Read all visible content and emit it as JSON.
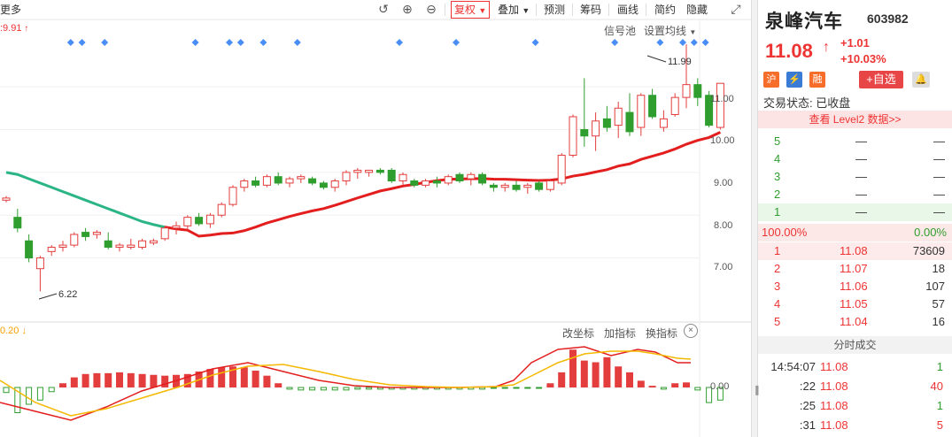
{
  "toolbar": {
    "more_label": "更多",
    "undo_icon": "undo-icon",
    "zoom_in_icon": "zoom-in-icon",
    "zoom_out_icon": "zoom-out-icon",
    "fq_label": "复权",
    "overlay_label": "叠加",
    "forecast_label": "预测",
    "chips_label": "筹码",
    "draw_label": "画线",
    "simple_label": "简约",
    "hide_label": "隐藏",
    "fullscreen_icon": "fullscreen-icon"
  },
  "kline": {
    "ma_label": ":9.91",
    "signal_pool_label": "信号池",
    "set_ma_label": "设置均线",
    "y_ticks": [
      "11.00",
      "10.00",
      "9.00",
      "8.00",
      "7.00"
    ],
    "high_marker": "11.99",
    "low_marker": "6.22",
    "colors": {
      "up": "#e33d3d",
      "down": "#2f9e2f",
      "ma_green": "#2bb585",
      "ma_yellow": "#f5b800",
      "ma_red": "#e31e1e",
      "signal": "#4a8ef5"
    }
  },
  "indicator": {
    "value_label": "0.20",
    "change_axis_label": "改坐标",
    "add_indicator_label": "加指标",
    "switch_indicator_label": "换指标",
    "close_icon": "close-icon",
    "zero_label": "0.00"
  },
  "quote": {
    "name": "泉峰汽车",
    "code": "603982",
    "price": "11.08",
    "change": "+1.01",
    "change_pct": "+10.03%",
    "badge_hu": "沪",
    "badge_lightning": "⚡",
    "badge_rong": "融",
    "fav_label": "+自选",
    "status_label": "交易状态:",
    "status_value": "已收盘",
    "level2_label": "查看 Level2 数据>>",
    "sell_levels": [
      {
        "level": "5",
        "price": "—",
        "vol": "—"
      },
      {
        "level": "4",
        "price": "—",
        "vol": "—"
      },
      {
        "level": "3",
        "price": "—",
        "vol": "—"
      },
      {
        "level": "2",
        "price": "—",
        "vol": "—"
      },
      {
        "level": "1",
        "price": "—",
        "vol": "—"
      }
    ],
    "ratio_left": "100.00%",
    "ratio_right": "0.00%",
    "buy_levels": [
      {
        "level": "1",
        "price": "11.08",
        "vol": "73609"
      },
      {
        "level": "2",
        "price": "11.07",
        "vol": "18"
      },
      {
        "level": "3",
        "price": "11.06",
        "vol": "107"
      },
      {
        "level": "4",
        "price": "11.05",
        "vol": "57"
      },
      {
        "level": "5",
        "price": "11.04",
        "vol": "16"
      }
    ],
    "ticks_header": "分时成交",
    "ticks": [
      {
        "time": "14:54:07",
        "price": "11.08",
        "vol": "1"
      },
      {
        "time": ":22",
        "price": "11.08",
        "vol": "40"
      },
      {
        "time": ":25",
        "price": "11.08",
        "vol": "1"
      },
      {
        "time": ":31",
        "price": "11.08",
        "vol": "5"
      }
    ]
  },
  "chart_data": {
    "type": "candlestick",
    "ylim": [
      6.0,
      12.2
    ],
    "candles": [
      [
        8.35,
        8.45,
        8.3,
        8.4
      ],
      [
        7.95,
        8.15,
        7.6,
        7.7
      ],
      [
        7.4,
        7.55,
        6.9,
        7.0
      ],
      [
        6.75,
        7.05,
        6.22,
        7.0
      ],
      [
        7.15,
        7.3,
        7.05,
        7.25
      ],
      [
        7.25,
        7.4,
        7.15,
        7.3
      ],
      [
        7.3,
        7.6,
        7.25,
        7.55
      ],
      [
        7.6,
        7.7,
        7.4,
        7.5
      ],
      [
        7.55,
        7.65,
        7.45,
        7.6
      ],
      [
        7.4,
        7.6,
        7.2,
        7.25
      ],
      [
        7.25,
        7.35,
        7.15,
        7.3
      ],
      [
        7.25,
        7.45,
        7.2,
        7.3
      ],
      [
        7.25,
        7.45,
        7.2,
        7.4
      ],
      [
        7.35,
        7.45,
        7.3,
        7.4
      ],
      [
        7.45,
        7.75,
        7.4,
        7.7
      ],
      [
        7.7,
        7.85,
        7.55,
        7.75
      ],
      [
        7.75,
        8.0,
        7.65,
        7.95
      ],
      [
        7.95,
        8.05,
        7.75,
        7.8
      ],
      [
        7.8,
        8.05,
        7.7,
        8.0
      ],
      [
        8.0,
        8.3,
        7.95,
        8.25
      ],
      [
        8.25,
        8.7,
        8.2,
        8.65
      ],
      [
        8.65,
        8.85,
        8.55,
        8.8
      ],
      [
        8.8,
        8.9,
        8.65,
        8.7
      ],
      [
        8.7,
        8.95,
        8.65,
        8.9
      ],
      [
        8.9,
        9.0,
        8.7,
        8.75
      ],
      [
        8.75,
        8.9,
        8.65,
        8.85
      ],
      [
        8.85,
        8.95,
        8.75,
        8.9
      ],
      [
        8.85,
        8.9,
        8.7,
        8.75
      ],
      [
        8.75,
        8.8,
        8.6,
        8.65
      ],
      [
        8.65,
        8.85,
        8.55,
        8.8
      ],
      [
        8.8,
        9.05,
        8.7,
        9.0
      ],
      [
        9.0,
        9.1,
        8.85,
        9.05
      ],
      [
        9.0,
        9.05,
        8.9,
        9.05
      ],
      [
        9.05,
        9.1,
        8.95,
        9.0
      ],
      [
        9.05,
        9.1,
        8.75,
        8.8
      ],
      [
        8.8,
        9.0,
        8.7,
        8.95
      ],
      [
        8.8,
        8.85,
        8.65,
        8.7
      ],
      [
        8.7,
        8.85,
        8.65,
        8.8
      ],
      [
        8.8,
        8.9,
        8.65,
        8.75
      ],
      [
        8.75,
        8.95,
        8.7,
        8.9
      ],
      [
        8.95,
        9.0,
        8.75,
        8.8
      ],
      [
        8.85,
        9.0,
        8.7,
        8.95
      ],
      [
        8.95,
        9.0,
        8.7,
        8.75
      ],
      [
        8.7,
        8.75,
        8.55,
        8.65
      ],
      [
        8.65,
        8.75,
        8.55,
        8.7
      ],
      [
        8.7,
        8.8,
        8.55,
        8.6
      ],
      [
        8.65,
        8.75,
        8.5,
        8.7
      ],
      [
        8.75,
        8.8,
        8.55,
        8.6
      ],
      [
        8.6,
        8.85,
        8.55,
        8.8
      ],
      [
        8.75,
        9.45,
        8.7,
        9.4
      ],
      [
        9.4,
        10.35,
        9.35,
        10.3
      ],
      [
        10.0,
        11.2,
        9.6,
        9.85
      ],
      [
        9.85,
        10.4,
        9.5,
        10.2
      ],
      [
        10.25,
        10.55,
        9.95,
        10.05
      ],
      [
        10.1,
        10.65,
        9.8,
        10.5
      ],
      [
        10.4,
        10.85,
        9.85,
        9.95
      ],
      [
        10.05,
        10.85,
        9.85,
        10.8
      ],
      [
        10.8,
        10.95,
        10.25,
        10.3
      ],
      [
        10.05,
        10.45,
        9.95,
        10.25
      ],
      [
        10.35,
        10.85,
        10.3,
        10.75
      ],
      [
        10.75,
        11.99,
        10.5,
        11.05
      ],
      [
        11.05,
        11.2,
        10.55,
        10.75
      ],
      [
        10.8,
        10.9,
        10.05,
        10.1
      ],
      [
        10.05,
        11.08,
        10.0,
        11.08
      ]
    ]
  }
}
